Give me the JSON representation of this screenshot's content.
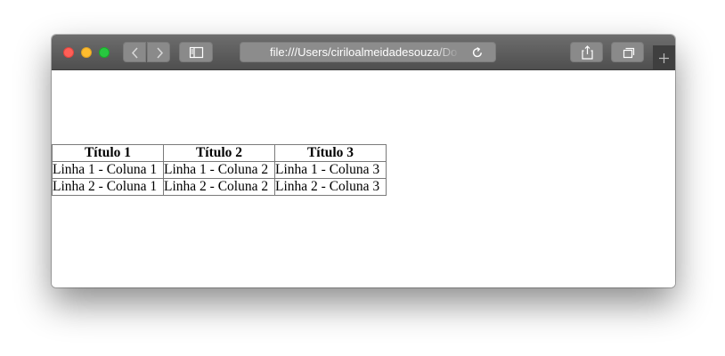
{
  "browser": {
    "address_text": "file:///Users/ciriloalmeidadesouza/Do",
    "icons": {
      "back": "chevron-left-icon",
      "forward": "chevron-right-icon",
      "sidebar": "sidebar-icon",
      "reload": "reload-icon",
      "share": "share-icon",
      "tabs": "tabs-overview-icon",
      "new_tab": "plus-icon"
    },
    "colors": {
      "titlebar": "#5f5f5f",
      "close": "#fe5f57",
      "minimize": "#febc2e",
      "maximize": "#28c840"
    }
  },
  "table": {
    "headers": [
      "Título 1",
      "Título 2",
      "Título 3"
    ],
    "rows": [
      [
        "Linha 1 - Coluna 1",
        "Linha 1 - Coluna 2",
        "Linha 1 - Coluna 3"
      ],
      [
        "Linha 2 - Coluna 1",
        "Linha 2 - Coluna 2",
        "Linha 2 - Coluna 3"
      ]
    ]
  }
}
